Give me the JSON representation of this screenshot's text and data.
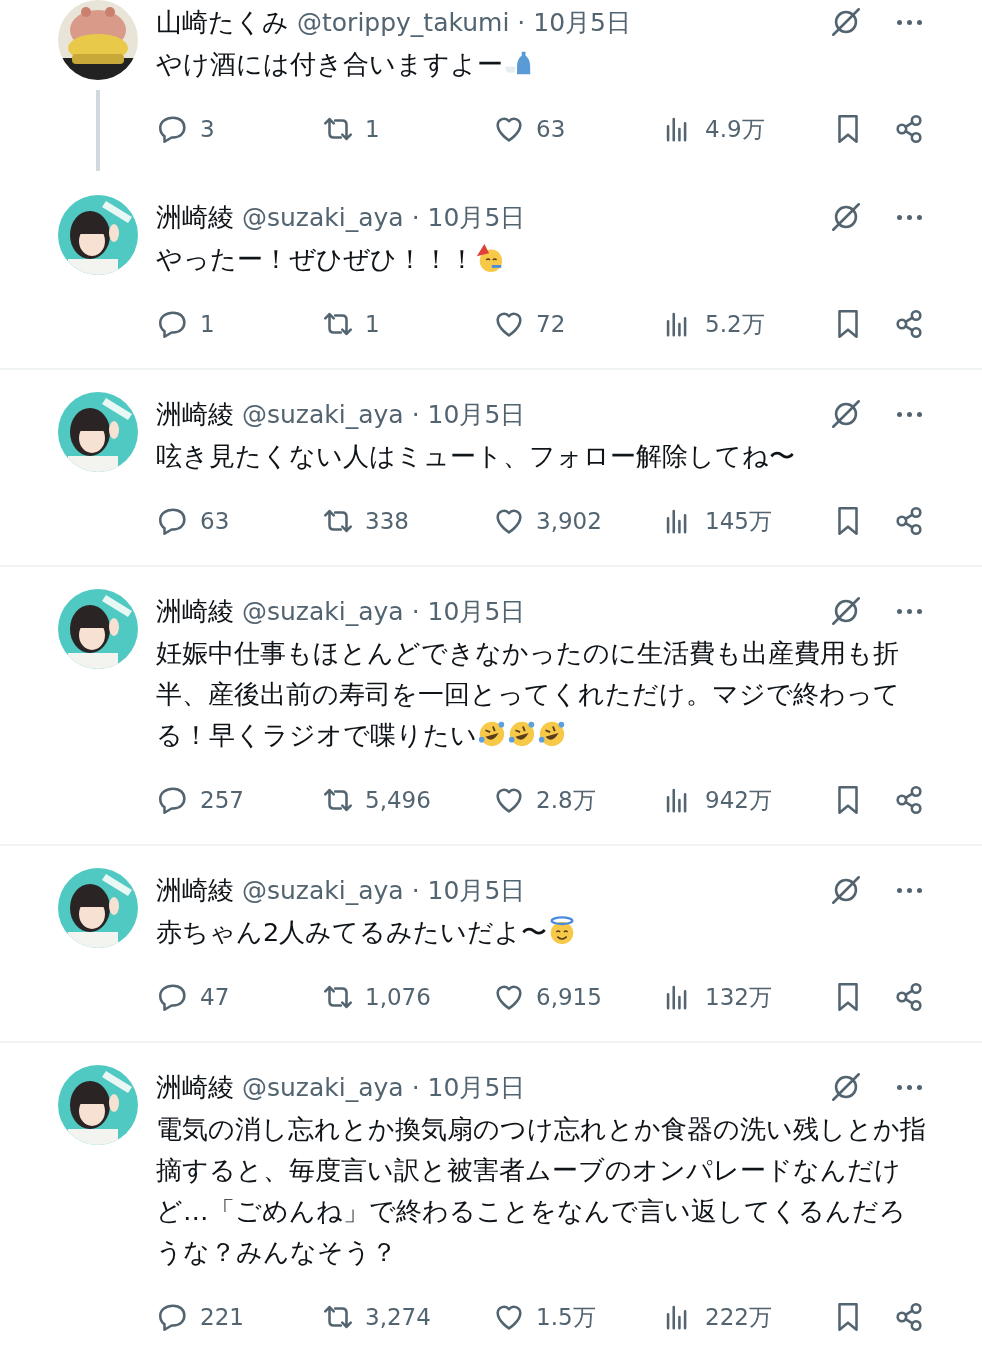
{
  "posts": [
    {
      "avatar": {
        "kind": "plush"
      },
      "name": "山崎たくみ",
      "handle": "@torippy_takumi",
      "date": "· 10月5日",
      "text": "やけ酒には付き合いますよー",
      "emojis": [
        {
          "kind": "sake"
        }
      ],
      "thread_continues": true,
      "replies": "3",
      "reposts": "1",
      "likes": "63",
      "views": "4.9万"
    },
    {
      "avatar": {
        "kind": "girl"
      },
      "name": "洲崎綾",
      "handle": "@suzaki_aya",
      "date": "· 10月5日",
      "text": "やったー！ぜひぜひ！！！",
      "emojis": [
        {
          "kind": "party"
        }
      ],
      "thread_continues": false,
      "replies": "1",
      "reposts": "1",
      "likes": "72",
      "views": "5.2万"
    },
    {
      "avatar": {
        "kind": "girl"
      },
      "name": "洲崎綾",
      "handle": "@suzaki_aya",
      "date": "· 10月5日",
      "text": "呟き見たくない人はミュート、フォロー解除してね〜",
      "thread_continues": false,
      "replies": "63",
      "reposts": "338",
      "likes": "3,902",
      "views": "145万"
    },
    {
      "avatar": {
        "kind": "girl"
      },
      "name": "洲崎綾",
      "handle": "@suzaki_aya",
      "date": "· 10月5日",
      "text": "妊娠中仕事もほとんどできなかったのに生活費も出産費用も折半、産後出前の寿司を一回とってくれただけ。マジで終わってる！早くラジオで喋りたい",
      "emojis": [
        {
          "kind": "rofl"
        },
        {
          "kind": "rofl"
        },
        {
          "kind": "rofl"
        }
      ],
      "thread_continues": false,
      "replies": "257",
      "reposts": "5,496",
      "likes": "2.8万",
      "views": "942万"
    },
    {
      "avatar": {
        "kind": "girl"
      },
      "name": "洲崎綾",
      "handle": "@suzaki_aya",
      "date": "· 10月5日",
      "text": "赤ちゃん2人みてるみたいだよ〜",
      "emojis": [
        {
          "kind": "halo"
        }
      ],
      "thread_continues": false,
      "replies": "47",
      "reposts": "1,076",
      "likes": "6,915",
      "views": "132万"
    },
    {
      "avatar": {
        "kind": "girl"
      },
      "name": "洲崎綾",
      "handle": "@suzaki_aya",
      "date": "· 10月5日",
      "text": "電気の消し忘れとか換気扇のつけ忘れとか食器の洗い残しとか指摘すると、毎度言い訳と被害者ムーブのオンパレードなんだけど…「ごめんね」で終わることをなんで言い返してくるんだろうな？みんなそう？",
      "thread_continues": false,
      "replies": "221",
      "reposts": "3,274",
      "likes": "1.5万",
      "views": "222万"
    }
  ]
}
